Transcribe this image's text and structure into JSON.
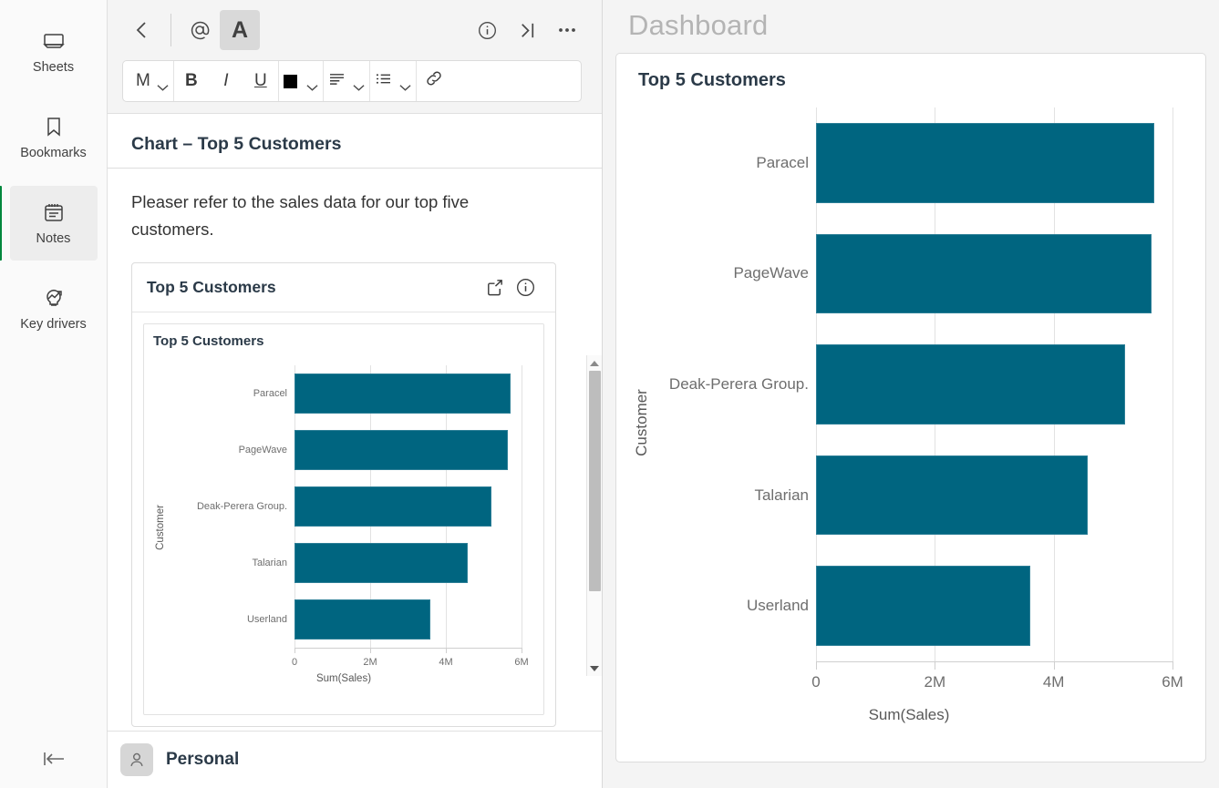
{
  "sidebar": {
    "items": [
      {
        "label": "Sheets",
        "icon": "sheets-icon",
        "active": false
      },
      {
        "label": "Bookmarks",
        "icon": "bookmark-icon",
        "active": false
      },
      {
        "label": "Notes",
        "icon": "notes-icon",
        "active": true
      },
      {
        "label": "Key drivers",
        "icon": "key-drivers-icon",
        "active": false
      }
    ],
    "collapse_icon": "collapse-left-icon",
    "active_accent": "#00873d"
  },
  "notes_panel": {
    "toolbar": {
      "back_icon": "chevron-left-icon",
      "mention_icon": "at-mention-icon",
      "format_text_label": "A",
      "info_icon": "info-icon",
      "collapse_panel_icon": "collapse-right-icon",
      "more_icon": "more-options-icon",
      "format_bar": {
        "size_label": "M",
        "bold_label": "B",
        "italic_label": "I",
        "underline_label": "U",
        "color_swatch": "#000000",
        "align_icon": "align-left-icon",
        "list_icon": "bullet-list-icon",
        "link_icon": "link-icon"
      }
    },
    "note_title": "Chart – Top 5 Customers",
    "note_text": "Pleaser refer to the sales data for our top five customers.",
    "embedded_card": {
      "title": "Top 5 Customers",
      "open_icon": "open-external-icon",
      "info_icon": "info-icon"
    },
    "footer": {
      "avatar_icon": "person-icon",
      "name": "Personal"
    },
    "scrollbar": {
      "up_icon": "scroll-up-icon",
      "down_icon": "scroll-down-icon"
    }
  },
  "dashboard": {
    "title": "Dashboard",
    "card_title": "Top 5 Customers"
  },
  "chart_data": [
    {
      "id": "embedded",
      "type": "bar",
      "orientation": "horizontal",
      "title": "Top 5 Customers",
      "categories": [
        "Paracel",
        "PageWave",
        "Deak-Perera Group.",
        "Talarian",
        "Userland"
      ],
      "values": [
        5700000,
        5640000,
        5200000,
        4580000,
        3600000
      ],
      "xlabel": "Sum(Sales)",
      "ylabel": "Customer",
      "xlim": [
        0,
        6000000
      ],
      "xticks": [
        0,
        2000000,
        4000000,
        6000000
      ],
      "xticklabels": [
        "0",
        "2M",
        "4M",
        "6M"
      ],
      "bar_color": "#006580",
      "grid": true,
      "legend": "none"
    },
    {
      "id": "dashboard",
      "type": "bar",
      "orientation": "horizontal",
      "title": "Top 5 Customers",
      "categories": [
        "Paracel",
        "PageWave",
        "Deak-Perera Group.",
        "Talarian",
        "Userland"
      ],
      "values": [
        5700000,
        5640000,
        5200000,
        4580000,
        3600000
      ],
      "xlabel": "Sum(Sales)",
      "ylabel": "Customer",
      "xlim": [
        0,
        6000000
      ],
      "xticks": [
        0,
        2000000,
        4000000,
        6000000
      ],
      "xticklabels": [
        "0",
        "2M",
        "4M",
        "6M"
      ],
      "bar_color": "#006580",
      "grid": true,
      "legend": "none"
    }
  ]
}
